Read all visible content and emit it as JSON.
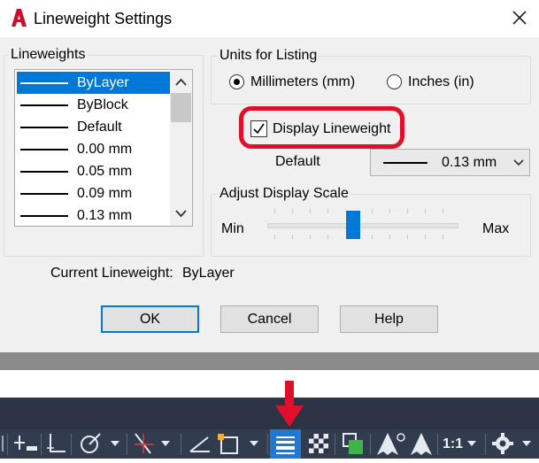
{
  "window": {
    "title": "Lineweight Settings",
    "close_symbol": "✕"
  },
  "lineweights": {
    "group_label": "Lineweights",
    "items": [
      {
        "label": "ByLayer",
        "selected": true
      },
      {
        "label": "ByBlock",
        "selected": false
      },
      {
        "label": "Default",
        "selected": false
      },
      {
        "label": "0.00 mm",
        "selected": false
      },
      {
        "label": "0.05 mm",
        "selected": false
      },
      {
        "label": "0.09 mm",
        "selected": false
      },
      {
        "label": "0.13 mm",
        "selected": false
      }
    ]
  },
  "units": {
    "group_label": "Units for Listing",
    "options": [
      {
        "label": "Millimeters (mm)",
        "checked": true
      },
      {
        "label": "Inches (in)",
        "checked": false
      }
    ]
  },
  "display_lineweight": {
    "label": "Display Lineweight",
    "checked": true,
    "highlight_color": "#e0102a"
  },
  "default_setting": {
    "label": "Default",
    "value": "0.13 mm"
  },
  "scale": {
    "group_label": "Adjust Display Scale",
    "min_label": "Min",
    "max_label": "Max"
  },
  "current": {
    "label": "Current Lineweight:",
    "value": "ByLayer"
  },
  "buttons": {
    "ok": "OK",
    "cancel": "Cancel",
    "help": "Help"
  },
  "statusbar": {
    "scale_label": "1:1",
    "accent_color": "#1f78d1",
    "icons": [
      "snap-icon",
      "ortho-icon",
      "polar-tracking-icon",
      "object-snap-tracking-icon",
      "object-snap-icon",
      "lineweight-icon",
      "transparency-icon",
      "selection-cycling-icon",
      "annotation-visibility-icon",
      "annotation-scale-icon",
      "workspace-gear-icon"
    ]
  },
  "annotation": {
    "arrow_color": "#e0102a"
  }
}
